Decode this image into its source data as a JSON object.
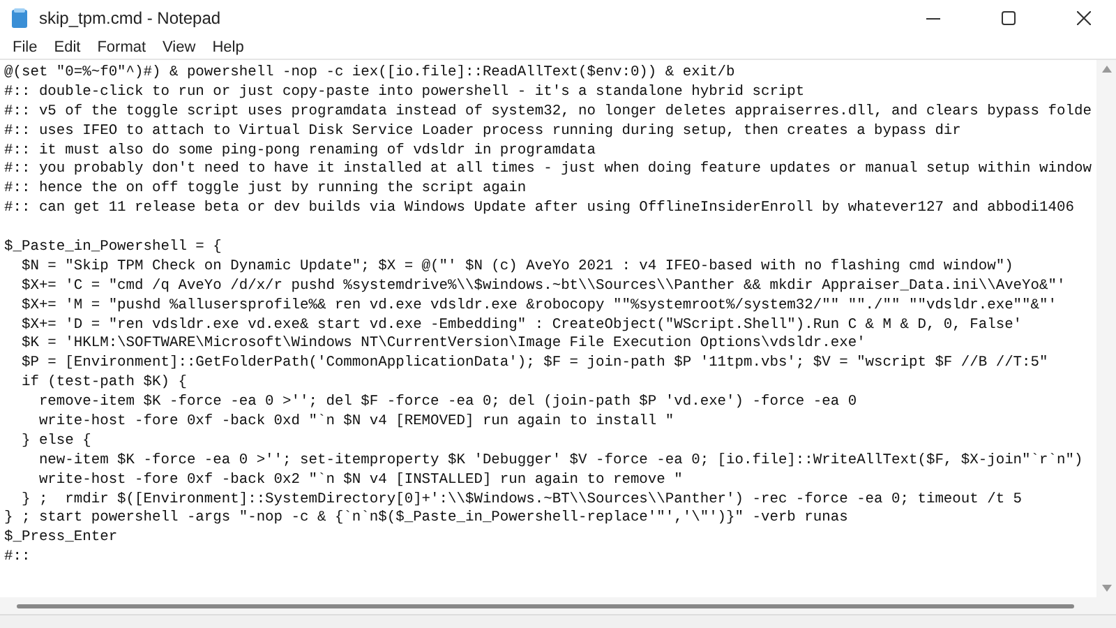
{
  "window": {
    "title": "skip_tpm.cmd - Notepad"
  },
  "menu": [
    {
      "label": "File"
    },
    {
      "label": "Edit"
    },
    {
      "label": "Format"
    },
    {
      "label": "View"
    },
    {
      "label": "Help"
    }
  ],
  "editor": {
    "blocks": [
      [
        "@(set \"0=%~f0\"^)#) & powershell -nop -c iex([io.file]::ReadAllText($env:0)) & exit/b",
        "#:: double-click to run or just copy-paste into powershell - it's a standalone hybrid script",
        "#:: v5 of the toggle script uses programdata instead of system32, no longer deletes appraiserres.dll, and clears bypass folde",
        "#:: uses IFEO to attach to Virtual Disk Service Loader process running during setup, then creates a bypass dir",
        "#:: it must also do some ping-pong renaming of vdsldr in programdata",
        "#:: you probably don't need to have it installed at all times - just when doing feature updates or manual setup within window",
        "#:: hence the on off toggle just by running the script again",
        "#:: can get 11 release beta or dev builds via Windows Update after using OfflineInsiderEnroll by whatever127 and abbodi1406"
      ],
      [
        "$_Paste_in_Powershell = {",
        "  $N = \"Skip TPM Check on Dynamic Update\"; $X = @(\"' $N (c) AveYo 2021 : v4 IFEO-based with no flashing cmd window\")",
        "  $X+= 'C = \"cmd /q AveYo /d/x/r pushd %systemdrive%\\\\$windows.~bt\\\\Sources\\\\Panther && mkdir Appraiser_Data.ini\\\\AveYo&\"'",
        "  $X+= 'M = \"pushd %allusersprofile%& ren vd.exe vdsldr.exe &robocopy \"\"%systemroot%/system32/\"\" \"\"./\"\" \"\"vdsldr.exe\"\"&\"'",
        "  $X+= 'D = \"ren vdsldr.exe vd.exe& start vd.exe -Embedding\" : CreateObject(\"WScript.Shell\").Run C & M & D, 0, False'",
        "  $K = 'HKLM:\\SOFTWARE\\Microsoft\\Windows NT\\CurrentVersion\\Image File Execution Options\\vdsldr.exe'",
        "  $P = [Environment]::GetFolderPath('CommonApplicationData'); $F = join-path $P '11tpm.vbs'; $V = \"wscript $F //B //T:5\"",
        "  if (test-path $K) {",
        "    remove-item $K -force -ea 0 >''; del $F -force -ea 0; del (join-path $P 'vd.exe') -force -ea 0",
        "    write-host -fore 0xf -back 0xd \"`n $N v4 [REMOVED] run again to install \"",
        "  } else {",
        "    new-item $K -force -ea 0 >''; set-itemproperty $K 'Debugger' $V -force -ea 0; [io.file]::WriteAllText($F, $X-join\"`r`n\")",
        "    write-host -fore 0xf -back 0x2 \"`n $N v4 [INSTALLED] run again to remove \"",
        "  } ;  rmdir $([Environment]::SystemDirectory[0]+':\\\\$Windows.~BT\\\\Sources\\\\Panther') -rec -force -ea 0; timeout /t 5",
        "} ; start powershell -args \"-nop -c & {`n`n$($_Paste_in_Powershell-replace'\"','\\\"')}\" -verb runas",
        "$_Press_Enter",
        "#::"
      ]
    ]
  }
}
